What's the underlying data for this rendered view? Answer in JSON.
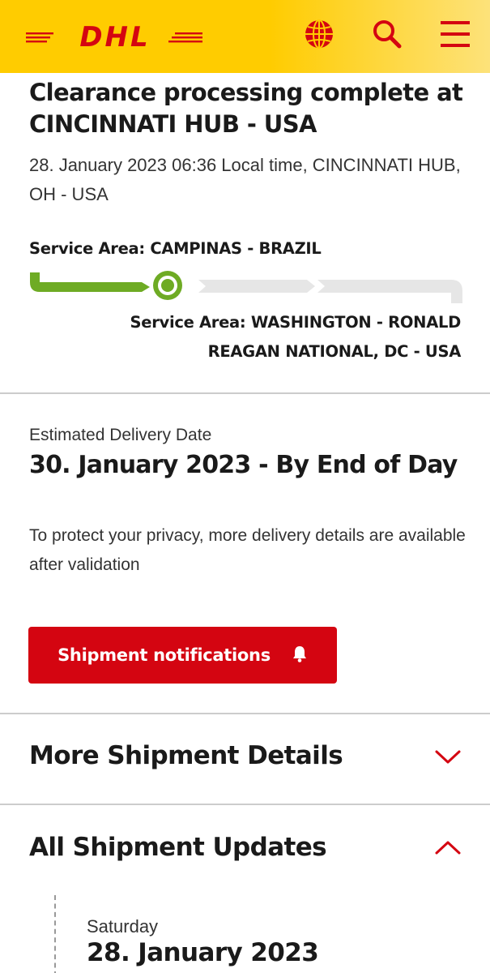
{
  "header": {
    "logo_text": "DHL",
    "icons": [
      "globe-icon",
      "search-icon",
      "menu-icon"
    ],
    "brand_yellow": "#ffcc00",
    "brand_red": "#d40511"
  },
  "status": {
    "title": "Clearance processing complete at CINCINNATI HUB - USA",
    "time_location": "28. January 2023 06:36 Local time, CINCINNATI HUB, OH - USA",
    "origin": "Service Area: CAMPINAS - BRAZIL",
    "destination": "Service Area: WASHINGTON - RONALD REAGAN NATIONAL, DC - USA",
    "progress_color": "#6eab24"
  },
  "delivery": {
    "label": "Estimated Delivery Date",
    "value": "30. January 2023 - By End of Day",
    "privacy_note": "To protect your privacy, more delivery details are available after validation",
    "notify_button": "Shipment notifications",
    "notify_icon": "bell-icon"
  },
  "sections": {
    "details_title": "More Shipment Details",
    "details_state": "collapsed",
    "updates_title": "All Shipment Updates",
    "updates_state": "expanded"
  },
  "timeline": {
    "day": "Saturday",
    "date": "28. January 2023"
  }
}
